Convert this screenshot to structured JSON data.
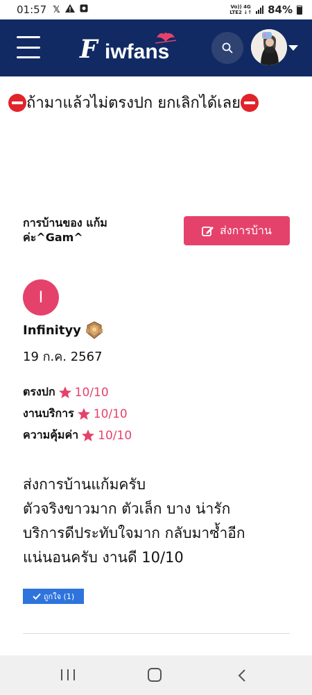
{
  "status_bar": {
    "time": "01:57",
    "icons": [
      "x-logo-icon",
      "warning-icon",
      "photo-icon"
    ],
    "network": [
      "Vo)) 4G",
      "LTE2 ↓↑"
    ],
    "battery": "84%"
  },
  "header": {
    "logo_initial": "F",
    "logo_rest": "iwfans",
    "colors": {
      "bar": "#112a63",
      "search_bg": "#2f4373"
    }
  },
  "headline": {
    "text": "ถ้ามาแล้วไม่ตรงปก ยกเลิกได้เลย"
  },
  "homework": {
    "title_line1": "การบ้านของ แก้ม",
    "title_line2": "ค่ะ^Gam^",
    "send_label": "ส่งการบ้าน",
    "accent": "#e5426b"
  },
  "review": {
    "avatar_letter": "I",
    "reviewer": "Infinityy",
    "date": "19 ก.ค. 2567",
    "ratings": [
      {
        "label": "ตรงปก",
        "value": "10/10"
      },
      {
        "label": "งานบริการ",
        "value": "10/10"
      },
      {
        "label": "ความคุ้มค่า",
        "value": "10/10"
      }
    ],
    "body": [
      "ส่งการบ้านแก้มครับ",
      "ตัวจริงขาวมาก ตัวเล็ก บาง น่ารัก",
      "บริการดีประทับใจมาก กลับมาซ้ำอีก",
      "แน่นอนครับ งานดี 10/10"
    ],
    "like_label": "ถูกใจ (1)"
  }
}
